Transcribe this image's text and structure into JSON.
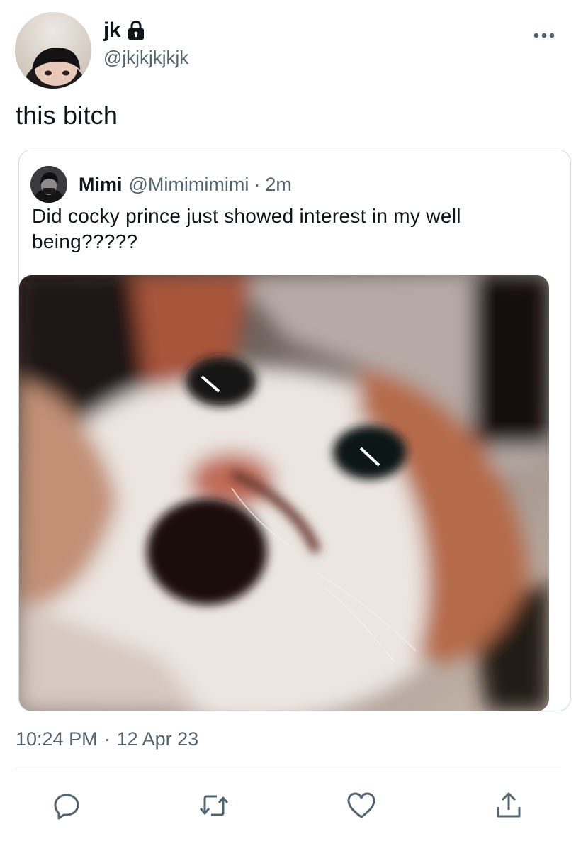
{
  "author": {
    "display_name": "jk",
    "handle": "@jkjkjkjkjk",
    "protected_icon": "lock-icon",
    "avatar_icon": "profile-photo"
  },
  "tweet": {
    "text": "this bitch",
    "time": "10:24 PM",
    "date": "12 Apr 23",
    "separator": "·"
  },
  "quoted_tweet": {
    "display_name": "Mimi",
    "handle": "@Mimimimimi",
    "separator": "·",
    "age": "2m",
    "text": "Did cocky prince just showed interest in my well being?????",
    "media_icon": "cat-photo"
  },
  "actions": {
    "reply_icon": "reply-icon",
    "retweet_icon": "retweet-icon",
    "like_icon": "heart-icon",
    "share_icon": "share-icon"
  },
  "colors": {
    "text": "#0f1419",
    "muted": "#536471",
    "border": "#cfd9de"
  }
}
